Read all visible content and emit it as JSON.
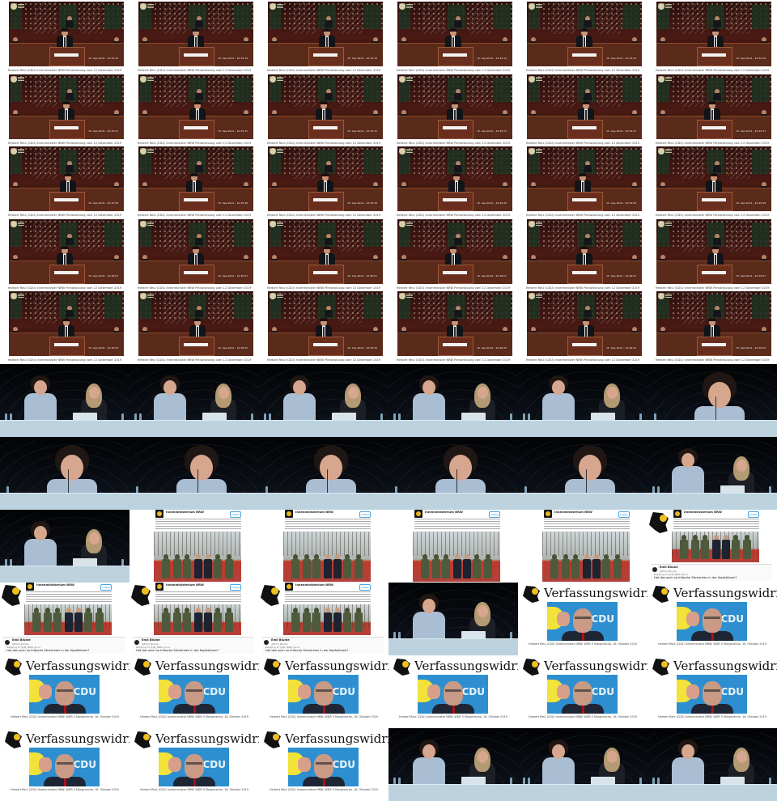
{
  "parliament": {
    "caption": "Herbert Reul (CDU) Innenminister NRW Plenarsitzung vom 12 Dezember 2019",
    "nameplate": "Herbert Reul (CDU)",
    "timestamps": [
      "15. Sep 2019 – 10:34:19",
      "15. Sep 2019 – 10:34:19",
      "15. Sep 2019 – 10:34:19",
      "15. Sep 2019 – 10:34:19",
      "15. Sep 2019 – 10:34:19",
      "15. Sep 2019 – 10:34:19",
      "15. Sep 2019 – 10:35:31",
      "15. Sep 2019 – 10:35:31",
      "15. Sep 2019 – 10:35:31",
      "15. Sep 2019 – 10:35:31",
      "15. Sep 2019 – 10:35:31",
      "15. Sep 2019 – 10:35:31",
      "15. Sep 2019 – 10:35:49",
      "15. Sep 2019 – 10:35:49",
      "15. Sep 2019 – 10:35:49",
      "15. Sep 2019 – 10:35:49",
      "15. Sep 2019 – 10:35:49",
      "15. Sep 2019 – 10:35:49",
      "15. Sep 2019 – 10:36:07",
      "15. Sep 2019 – 10:36:07",
      "15. Sep 2019 – 10:36:07",
      "15. Sep 2019 – 10:36:07",
      "15. Sep 2019 – 10:36:07",
      "15. Sep 2019 – 10:36:07",
      "15. Sep 2019 – 10:36:25",
      "15. Sep 2019 – 10:36:25",
      "15. Sep 2019 – 10:36:25",
      "15. Sep 2019 – 10:36:25",
      "15. Sep 2019 – 10:36:25",
      "15. Sep 2019 – 10:36:25"
    ]
  },
  "tweet": {
    "account": "Innenministerium NRW",
    "follow": "Follow",
    "reply_name": "Emil Blume",
    "reply_handle": "@Emil_Blume",
    "reply_to": "Replying to @IM_NRW @cvo",
    "reply_text": "Hat das auch so hübsche Stickereien in der Kopfstützen?"
  },
  "verfassungswidrig": {
    "title": "Verfassungswidrig?",
    "logo_text": "en",
    "party_text": "CDU",
    "caption": "Herbert Reul (CDU) Innenminister NRW: WDR 5 Morgenecho, 16. Oktober 2019"
  },
  "colors": {
    "parliament_bg": "#3a1410",
    "studio_bg": "#05070a",
    "studio_table": "#bcd3df",
    "verf_blue": "#2d8fd0",
    "nrw_yellow": "#f0c020"
  }
}
